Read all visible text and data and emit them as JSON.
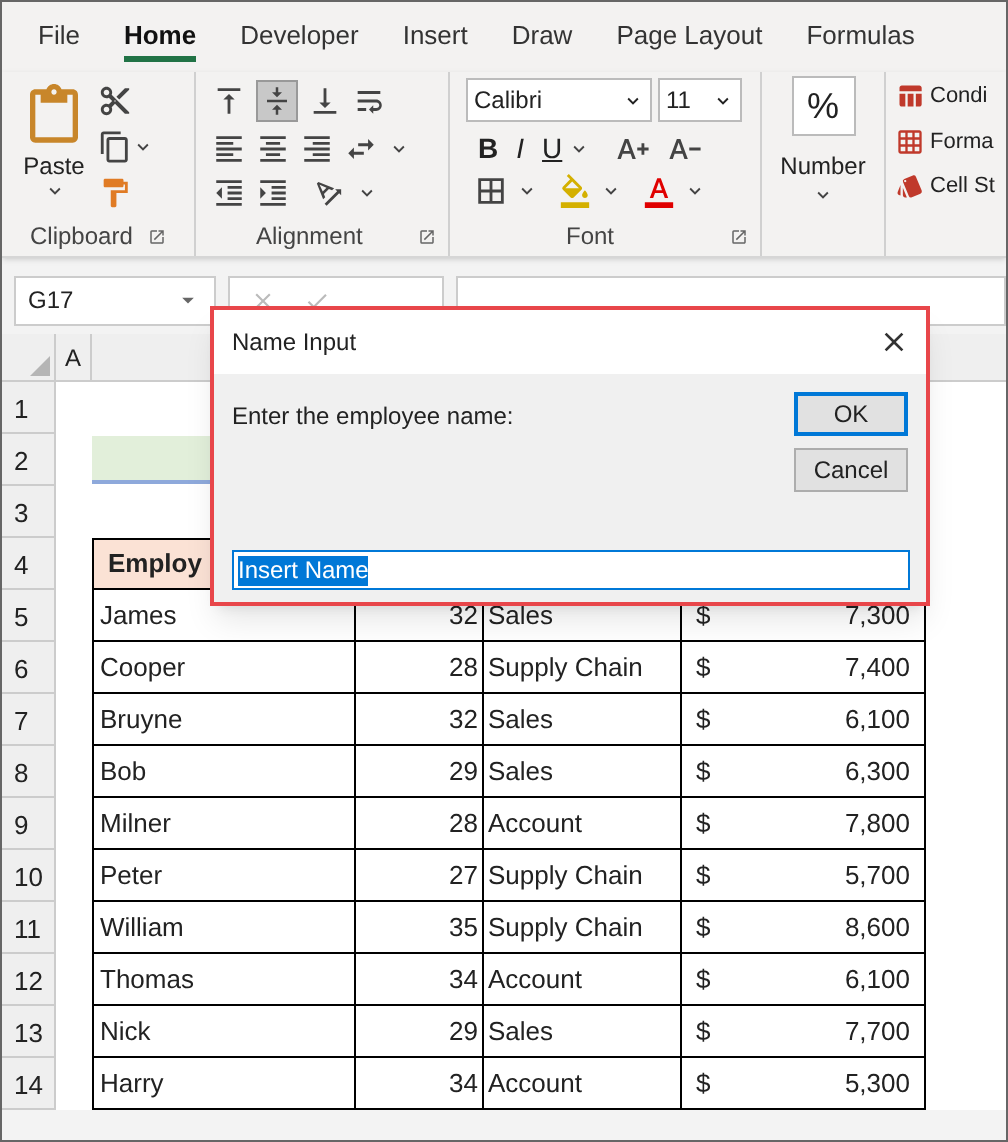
{
  "tabs": [
    {
      "label": "File",
      "selected": false
    },
    {
      "label": "Home",
      "selected": true
    },
    {
      "label": "Developer",
      "selected": false
    },
    {
      "label": "Insert",
      "selected": false
    },
    {
      "label": "Draw",
      "selected": false
    },
    {
      "label": "Page Layout",
      "selected": false
    },
    {
      "label": "Formulas",
      "selected": false
    }
  ],
  "ribbon": {
    "clipboard": {
      "paste_label": "Paste",
      "group_label": "Clipboard"
    },
    "alignment": {
      "group_label": "Alignment"
    },
    "font": {
      "font_name": "Calibri",
      "font_size": "11",
      "style_buttons": [
        "B",
        "I",
        "U"
      ],
      "group_label": "Font"
    },
    "number": {
      "symbol": "%",
      "label": "Number"
    },
    "styles": {
      "items": [
        "Condi",
        "Forma",
        "Cell St"
      ]
    }
  },
  "name_box": "G17",
  "column_header": "A",
  "row_numbers": [
    "1",
    "2",
    "3",
    "4",
    "5",
    "6",
    "7",
    "8",
    "9",
    "10",
    "11",
    "12",
    "13",
    "14"
  ],
  "table": {
    "header": "Employ",
    "rows": [
      {
        "name": "James",
        "age": "32",
        "department": "Sales",
        "currency": "$",
        "salary": "7,300"
      },
      {
        "name": "Cooper",
        "age": "28",
        "department": "Supply Chain",
        "currency": "$",
        "salary": "7,400"
      },
      {
        "name": "Bruyne",
        "age": "32",
        "department": "Sales",
        "currency": "$",
        "salary": "6,100"
      },
      {
        "name": "Bob",
        "age": "29",
        "department": "Sales",
        "currency": "$",
        "salary": "6,300"
      },
      {
        "name": "Milner",
        "age": "28",
        "department": "Account",
        "currency": "$",
        "salary": "7,800"
      },
      {
        "name": "Peter",
        "age": "27",
        "department": "Supply Chain",
        "currency": "$",
        "salary": "5,700"
      },
      {
        "name": "William",
        "age": "35",
        "department": "Supply Chain",
        "currency": "$",
        "salary": "8,600"
      },
      {
        "name": "Thomas",
        "age": "34",
        "department": "Account",
        "currency": "$",
        "salary": "6,100"
      },
      {
        "name": "Nick",
        "age": "29",
        "department": "Sales",
        "currency": "$",
        "salary": "7,700"
      },
      {
        "name": "Harry",
        "age": "34",
        "department": "Account",
        "currency": "$",
        "salary": "5,300"
      }
    ]
  },
  "dialog": {
    "title": "Name Input",
    "prompt": "Enter the employee name:",
    "buttons": [
      {
        "label": "OK",
        "default": true
      },
      {
        "label": "Cancel",
        "default": false
      }
    ],
    "input": {
      "value": "Insert Name",
      "text_selected": true
    }
  }
}
